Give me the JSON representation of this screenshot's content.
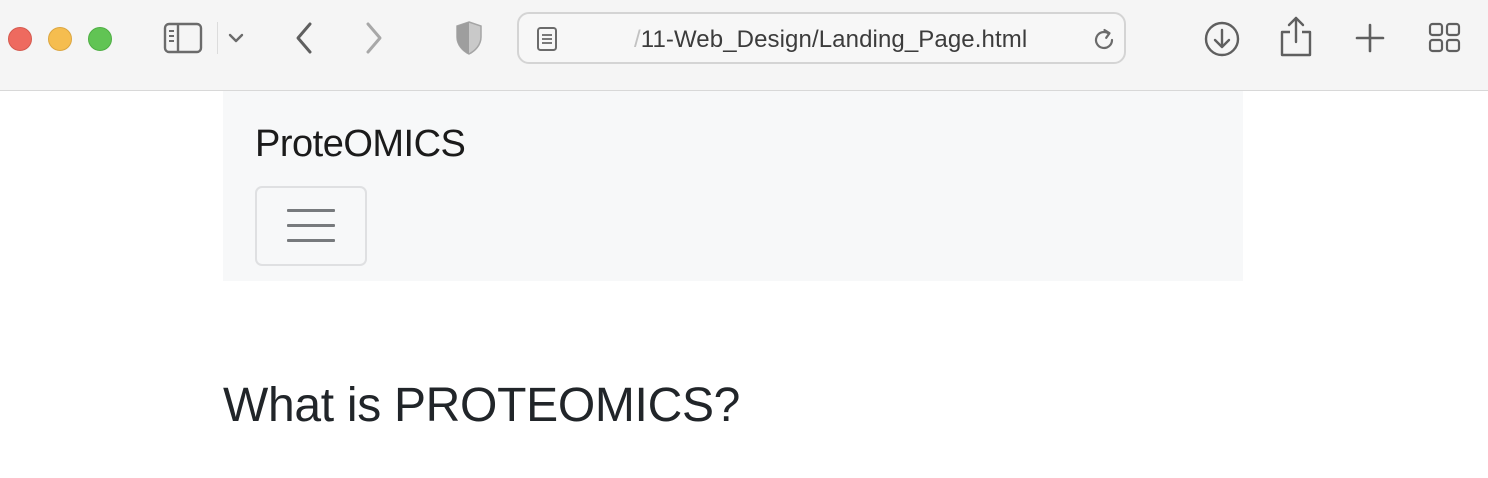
{
  "browser": {
    "url_faded_prefix": "/",
    "url_path": "11-Web_Design/Landing_Page.html",
    "icons": {
      "sidebar": "sidebar-icon",
      "chevron": "chevron-down-icon",
      "back": "back-arrow-icon",
      "forward": "forward-arrow-icon",
      "shield": "privacy-shield-icon",
      "page": "page-icon",
      "reload": "reload-icon",
      "downloads": "download-icon",
      "share": "share-icon",
      "new_tab": "plus-icon",
      "tab_overview": "tab-overview-icon"
    },
    "colors": {
      "close": "#ee6a5f",
      "minimize": "#f5bd4f",
      "maximize": "#61c454"
    }
  },
  "page": {
    "brand": "ProteOMICS",
    "heading": "What is PROTEOMICS?",
    "toggler_icon": "hamburger-menu-icon"
  }
}
